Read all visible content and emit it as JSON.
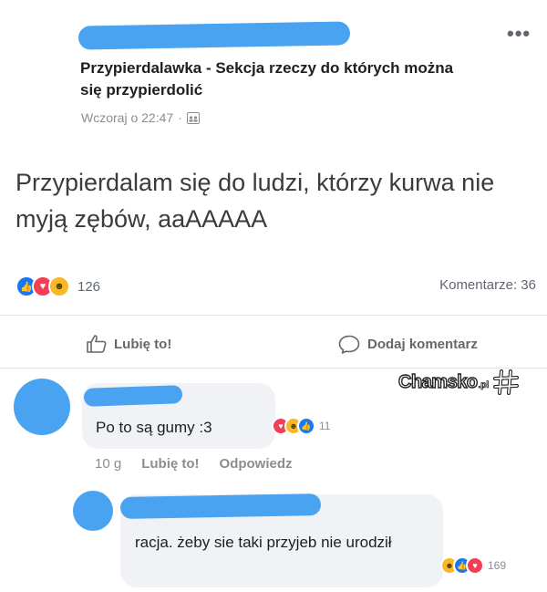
{
  "post": {
    "group_title": "Przypierdalawka - Sekcja rzeczy do których można się przypierdolić",
    "timestamp": "Wczoraj o 22:47",
    "separator": "·",
    "body": "Przypierdalam się do ludzi, którzy kurwa nie myją zębów, aaAAAAA",
    "reaction_count": "126",
    "comments_label": "Komentarze: 36",
    "reactions": [
      "like-icon",
      "love-icon",
      "haha-icon"
    ]
  },
  "actions": {
    "like": "Lubię to!",
    "comment": "Dodaj komentarz"
  },
  "comments": [
    {
      "text": "Po to są gumy :3",
      "reaction_count": "11",
      "time": "10 g",
      "like": "Lubię to!",
      "reply": "Odpowiedz"
    },
    {
      "text": "racja. żeby sie taki przyjeb nie urodził",
      "reaction_count": "169"
    }
  ],
  "watermark": {
    "text": "Chamsko",
    "suffix": ".pl"
  },
  "colors": {
    "redaction": "#4aa3f0",
    "like": "#1877f2",
    "love": "#f33e58",
    "haha": "#f7b928"
  }
}
